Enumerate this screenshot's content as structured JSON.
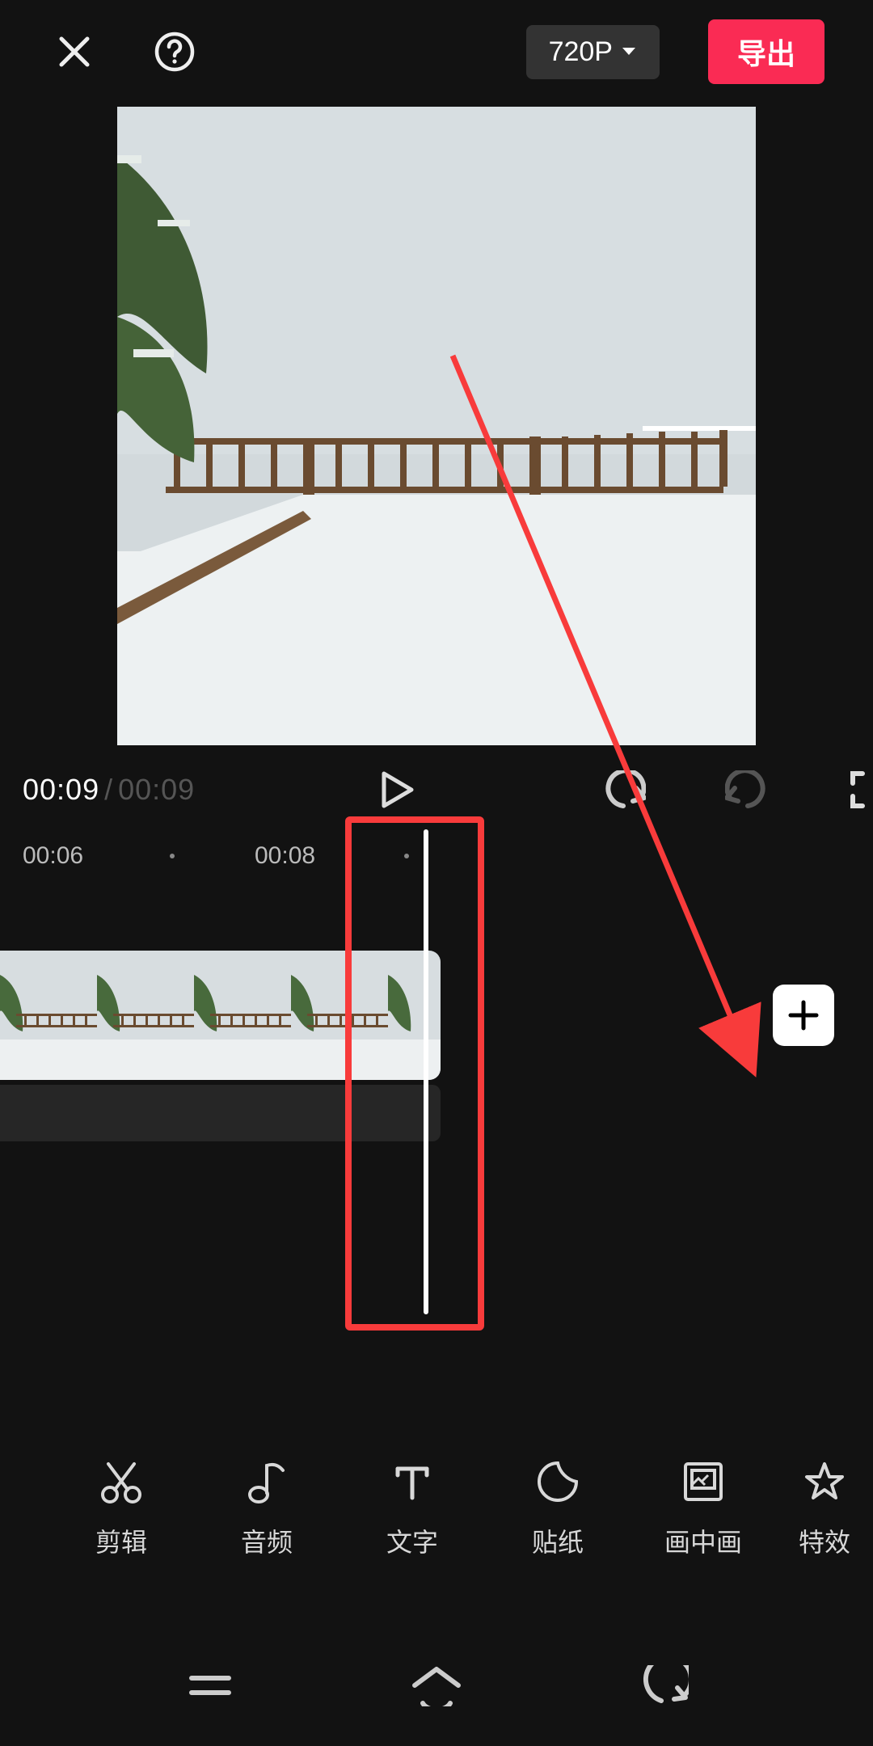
{
  "header": {
    "resolution": "720P",
    "export_label": "导出"
  },
  "transport": {
    "current": "00:09",
    "duration": "00:09"
  },
  "ruler": {
    "labels": [
      "00:06",
      "00:08"
    ]
  },
  "add_button": {
    "symbol": "+"
  },
  "tools": [
    {
      "id": "edit",
      "label": "剪辑",
      "icon": "scissors"
    },
    {
      "id": "audio",
      "label": "音频",
      "icon": "note"
    },
    {
      "id": "text",
      "label": "文字",
      "icon": "text-t"
    },
    {
      "id": "sticker",
      "label": "贴纸",
      "icon": "moon"
    },
    {
      "id": "pip",
      "label": "画中画",
      "icon": "pip"
    },
    {
      "id": "fx",
      "label": "特效",
      "icon": "star"
    }
  ]
}
